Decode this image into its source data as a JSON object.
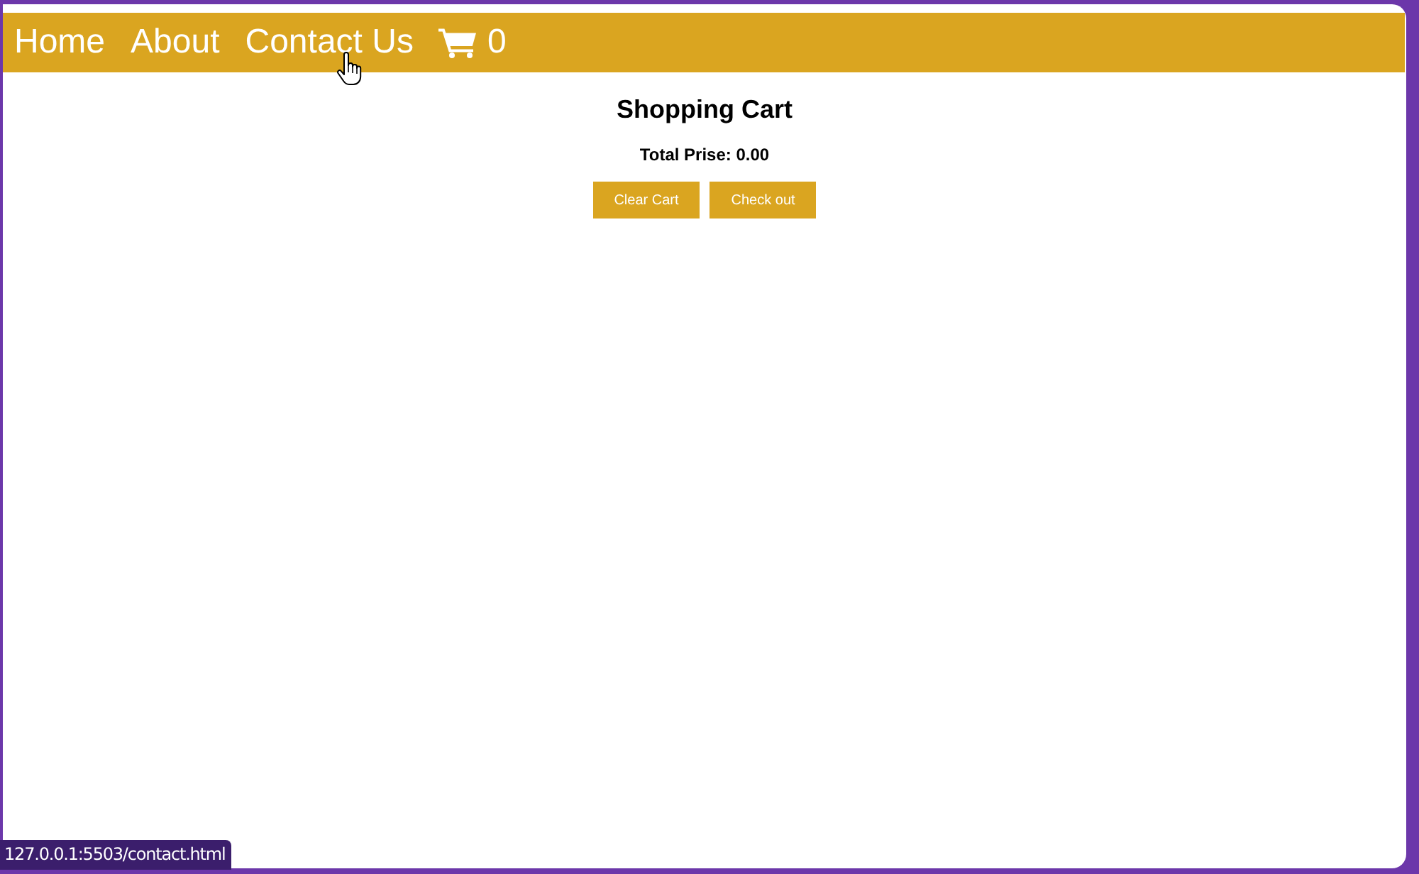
{
  "nav": {
    "links": [
      {
        "label": "Home"
      },
      {
        "label": "About"
      },
      {
        "label": "Contact Us"
      }
    ],
    "cart_count": "0"
  },
  "cart": {
    "title": "Shopping Cart",
    "total": "Total Prise: 0.00",
    "buttons": [
      "Clear Cart",
      "Check out"
    ]
  },
  "status_bar": {
    "url": "127.0.0.1:5503/contact.html"
  }
}
